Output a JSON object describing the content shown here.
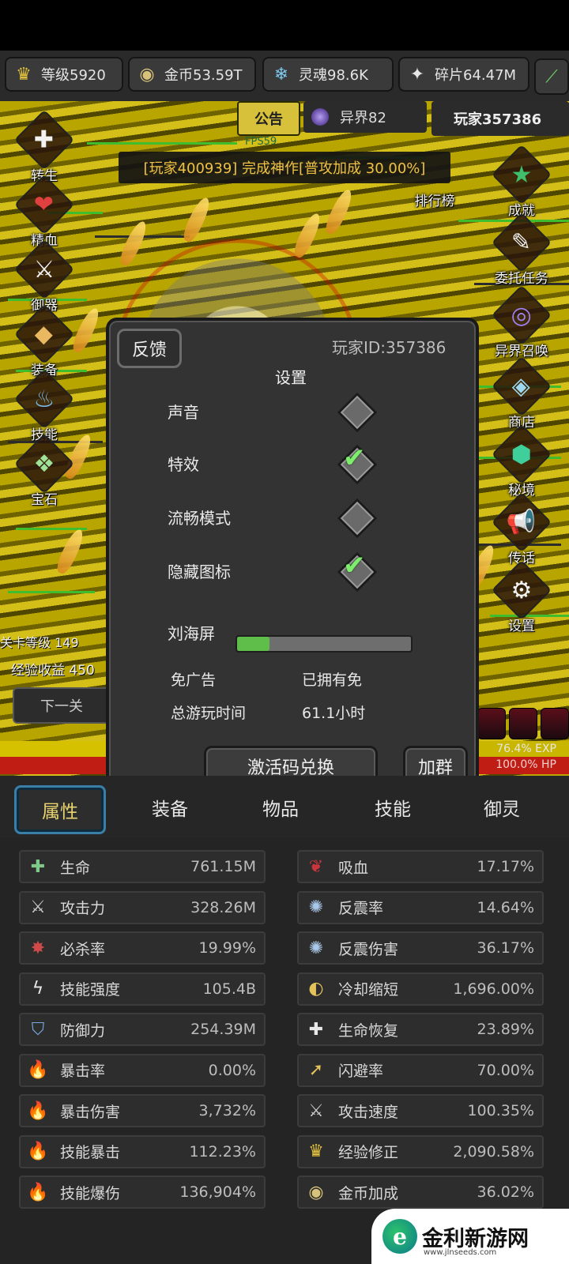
{
  "resources": [
    {
      "icon": "crown-icon",
      "glyph": "♛",
      "color": "#e7c53b",
      "text": "等级5920"
    },
    {
      "icon": "coin-icon",
      "glyph": "◉",
      "color": "#d8c27a",
      "text": "金币53.59T"
    },
    {
      "icon": "soul-icon",
      "glyph": "❄",
      "color": "#7fc8ef",
      "text": "灵魂98.6K"
    },
    {
      "icon": "shard-icon",
      "glyph": "✦",
      "color": "#e6e6e6",
      "text": "碎片64.47M"
    }
  ],
  "scene": {
    "notice_label": "公告",
    "realm_label": "异界82",
    "player_label": "玩家357386",
    "fps_text": "FPS59",
    "broadcast": "[玩家400939] 完成神作[普攻加成 30.00%]",
    "stage_level": "关卡等级 149",
    "exp_income": "经验收益 450",
    "next_label": "下一关",
    "exp_label": "76.4% EXP",
    "exp_fraction": 0.764,
    "hp_label": "100.0% HP"
  },
  "left_nav": [
    {
      "icon": "rebirth-icon",
      "glyph": "✚",
      "label": "转生"
    },
    {
      "icon": "essence-blood-icon",
      "glyph": "❤",
      "label": "精血"
    },
    {
      "icon": "spirit-guard-icon",
      "glyph": "⚔",
      "label": "御器"
    },
    {
      "icon": "equipment-icon",
      "glyph": "◆",
      "label": "装备"
    },
    {
      "icon": "skill-icon",
      "glyph": "♨",
      "label": "技能"
    },
    {
      "icon": "gem-icon",
      "glyph": "❖",
      "label": "宝石"
    }
  ],
  "right_nav": [
    {
      "icon": "ranking-icon",
      "glyph": "",
      "label": "排行榜"
    },
    {
      "icon": "achievement-icon",
      "glyph": "★",
      "label": "成就"
    },
    {
      "icon": "commission-icon",
      "glyph": "✎",
      "label": "委托任务"
    },
    {
      "icon": "realm-summon-icon",
      "glyph": "◎",
      "label": "异界召唤"
    },
    {
      "icon": "shop-icon",
      "glyph": "◈",
      "label": "商店"
    },
    {
      "icon": "secret-realm-icon",
      "glyph": "⬢",
      "label": "秘境"
    },
    {
      "icon": "legend-icon",
      "glyph": "📢",
      "label": "传话"
    },
    {
      "icon": "settings-icon",
      "glyph": "⚙",
      "label": "设置"
    }
  ],
  "modal": {
    "feedback_label": "反馈",
    "player_id": "玩家ID:357386",
    "title": "设置",
    "options": [
      {
        "label": "声音",
        "checked": false
      },
      {
        "label": "特效",
        "checked": true
      },
      {
        "label": "流畅模式",
        "checked": false
      },
      {
        "label": "隐藏图标",
        "checked": true
      }
    ],
    "notch_label": "刘海屏",
    "notch_fraction": 0.19,
    "ad_free_key": "免广告",
    "ad_free_value": "已拥有免",
    "playtime_key": "总游玩时间",
    "playtime_value": "61.1小时",
    "redeem_label": "激活码兑换",
    "join_label": "加群"
  },
  "tabs": [
    {
      "label": "属性",
      "active": true
    },
    {
      "label": "装备",
      "active": false
    },
    {
      "label": "物品",
      "active": false
    },
    {
      "label": "技能",
      "active": false
    },
    {
      "label": "御灵",
      "active": false
    }
  ],
  "stats_left": [
    {
      "icon": "life-icon",
      "glyph": "✚",
      "color": "#7fc98a",
      "name": "生命",
      "value": "761.15M"
    },
    {
      "icon": "sword-icon",
      "glyph": "⚔",
      "color": "#cfcfcf",
      "name": "攻击力",
      "value": "328.26M"
    },
    {
      "icon": "crit-kill-icon",
      "glyph": "✸",
      "color": "#d04a4a",
      "name": "必杀率",
      "value": "19.99%"
    },
    {
      "icon": "skill-power-icon",
      "glyph": "ϟ",
      "color": "#e8e8e8",
      "name": "技能强度",
      "value": "105.4B"
    },
    {
      "icon": "shield-icon",
      "glyph": "⛉",
      "color": "#7aa7e0",
      "name": "防御力",
      "value": "254.39M"
    },
    {
      "icon": "crit-rate-icon",
      "glyph": "🔥",
      "color": "#e9a53b",
      "name": "暴击率",
      "value": "0.00%"
    },
    {
      "icon": "crit-damage-icon",
      "glyph": "🔥",
      "color": "#e9a53b",
      "name": "暴击伤害",
      "value": "3,732%"
    },
    {
      "icon": "skill-crit-icon",
      "glyph": "🔥",
      "color": "#6fb4e8",
      "name": "技能暴击",
      "value": "112.23%"
    },
    {
      "icon": "skill-burst-icon",
      "glyph": "🔥",
      "color": "#6fb4e8",
      "name": "技能爆伤",
      "value": "136,904%"
    }
  ],
  "stats_right": [
    {
      "icon": "lifesteal-icon",
      "glyph": "❦",
      "color": "#c9353a",
      "name": "吸血",
      "value": "17.17%"
    },
    {
      "icon": "counter-rate-icon",
      "glyph": "✺",
      "color": "#a9c7e8",
      "name": "反震率",
      "value": "14.64%"
    },
    {
      "icon": "counter-damage-icon",
      "glyph": "✺",
      "color": "#a9c7e8",
      "name": "反震伤害",
      "value": "36.17%"
    },
    {
      "icon": "cooldown-icon",
      "glyph": "◐",
      "color": "#e3c25a",
      "name": "冷却缩短",
      "value": "1,696.00%"
    },
    {
      "icon": "regen-icon",
      "glyph": "✚",
      "color": "#e8e8e8",
      "name": "生命恢复",
      "value": "23.89%"
    },
    {
      "icon": "dodge-icon",
      "glyph": "➚",
      "color": "#e3c25a",
      "name": "闪避率",
      "value": "70.00%"
    },
    {
      "icon": "attack-speed-icon",
      "glyph": "⚔",
      "color": "#cfcfcf",
      "name": "攻击速度",
      "value": "100.35%"
    },
    {
      "icon": "exp-modifier-icon",
      "glyph": "♛",
      "color": "#e7c53b",
      "name": "经验修正",
      "value": "2,090.58%"
    },
    {
      "icon": "gold-bonus-icon",
      "glyph": "◉",
      "color": "#d8c27a",
      "name": "金币加成",
      "value": "36.02%"
    }
  ],
  "watermark": {
    "logo_letter": "e",
    "name": "金利新游网",
    "url": "www.jlnseeds.com"
  }
}
